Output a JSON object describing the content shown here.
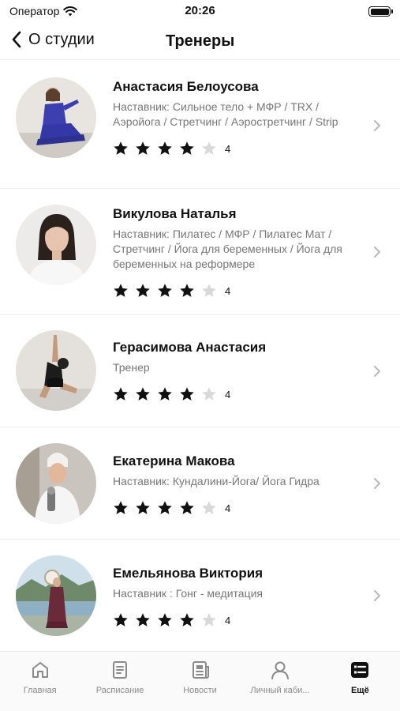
{
  "status_bar": {
    "carrier": "Оператор",
    "time": "20:26"
  },
  "nav": {
    "back_label": "О студии",
    "title": "Тренеры"
  },
  "trainers": [
    {
      "name": "Анастасия Белоусова",
      "role": "Наставник: Сильное тело + МФР / TRX / Аэройога / Стретчинг / Аэростретчинг / Strip",
      "rating": 4
    },
    {
      "name": "Викулова Наталья",
      "role": "Наставник: Пилатес / МФР / Пилатес Мат / Стретчинг / Йога для беременных / Йога для беременных на реформере",
      "rating": 4
    },
    {
      "name": "Герасимова Анастасия",
      "role": "Тренер",
      "rating": 4
    },
    {
      "name": "Екатерина Макова",
      "role": "Наставник: Кундалини-Йога/ Йога Гидра",
      "rating": 4
    },
    {
      "name": "Емельянова Виктория",
      "role": "Наставник : Гонг - медитация",
      "rating": 4
    }
  ],
  "tabs": [
    {
      "label": "Главная",
      "icon": "home-icon"
    },
    {
      "label": "Расписание",
      "icon": "schedule-icon"
    },
    {
      "label": "Новости",
      "icon": "news-icon"
    },
    {
      "label": "Личный каби...",
      "icon": "profile-icon"
    },
    {
      "label": "Ещё",
      "icon": "more-list-icon",
      "active": true
    }
  ],
  "colors": {
    "star_filled": "#111111",
    "star_empty": "#d9d9d9",
    "accent": "#111111",
    "muted": "#777777"
  }
}
